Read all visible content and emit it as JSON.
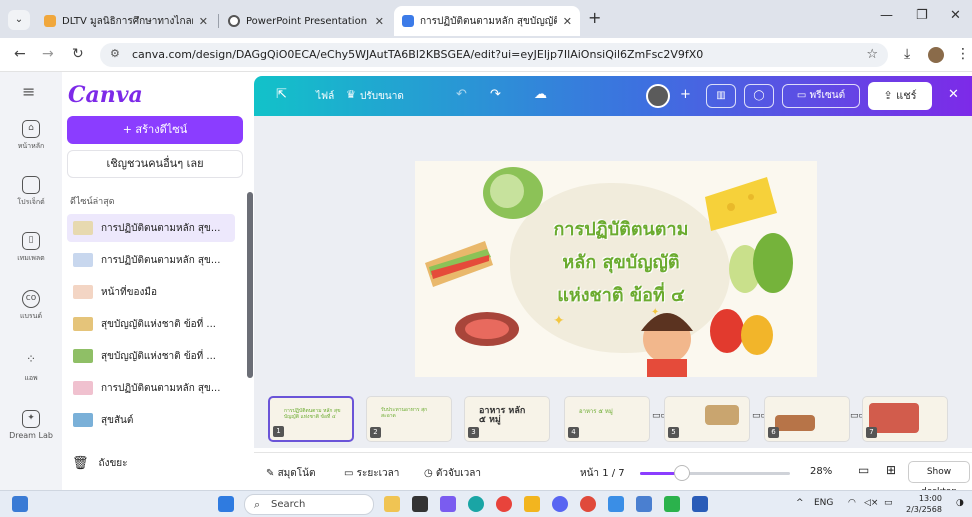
{
  "browser": {
    "tabs": [
      {
        "title": "DLTV มูลนิธิการศึกษาทางไกลผ่านดา",
        "active": false,
        "favicon_color": "#f0a73c"
      },
      {
        "title": "PowerPoint Presentation",
        "active": false,
        "favicon_color": "#555555"
      },
      {
        "title": "การปฏิบัติตนตามหลัก สุขบัญญัติแห่ง",
        "active": true,
        "favicon_color": "#3c7be8"
      }
    ],
    "url": "canva.com/design/DAGgQiO0ECA/eChy5WJAutTA6Bl2KBSGEA/edit?ui=eyJEljp7IlAiOnsiQil6ZmFsc2V9fX0"
  },
  "rail": {
    "items": [
      {
        "label": "หน้าหลัก",
        "icon": "home-icon"
      },
      {
        "label": "โปรเจ็กต์",
        "icon": "folder-icon"
      },
      {
        "label": "เทมเพลต",
        "icon": "template-icon"
      },
      {
        "label": "แบรนด์",
        "icon": "brand-icon"
      },
      {
        "label": "แอพ",
        "icon": "apps-icon"
      },
      {
        "label": "Dream Lab",
        "icon": "dream-lab-icon"
      }
    ]
  },
  "panel": {
    "logo": "Canva",
    "create_button": "+ สร้างดีไซน์",
    "invite_button": "เชิญชวนคนอื่นๆ เลย",
    "recent_label": "ดีไซน์ล่าสุด",
    "recent": [
      {
        "name": "การปฏิบัติตนตามหลัก สุข...",
        "selected": true,
        "thumb_color": "#e7d9b0"
      },
      {
        "name": "การปฏิบัติตนตามหลัก สุข...",
        "selected": false,
        "thumb_color": "#c8d7ee"
      },
      {
        "name": "หน้าที่ของมือ",
        "selected": false,
        "thumb_color": "#f3d5c4"
      },
      {
        "name": "สุขบัญญัติแห่งชาติ ข้อที่ ...",
        "selected": false,
        "thumb_color": "#e5c47a"
      },
      {
        "name": "สุขบัญญัติแห่งชาติ ข้อที่ ...",
        "selected": false,
        "thumb_color": "#8fbf66"
      },
      {
        "name": "การปฏิบัติตนตามหลัก สุข...",
        "selected": false,
        "thumb_color": "#f0c1cf"
      },
      {
        "name": "สุขสันต์",
        "selected": false,
        "thumb_color": "#7ab0d8"
      }
    ],
    "trash": "ถังขยะ"
  },
  "editor": {
    "file": "ไฟล์",
    "resize": "ปรับขนาด",
    "present": "พรีเซนต์",
    "share": "แชร์",
    "slide_title": [
      "การปฏิบัติตนตาม",
      "หลัก สุขบัญญัติ",
      "แห่งชาติ ข้อที่ ๔"
    ],
    "thumbnails": [
      {
        "num": "1",
        "text": "การปฏิบัติตนตาม หลัก สุขบัญญัติ แห่งชาติ ข้อที่ ๔",
        "selected": true
      },
      {
        "num": "2",
        "text": "รับประทานอาหาร สุก สะอาด",
        "selected": false
      },
      {
        "num": "3",
        "text": "อาหาร หลัก ๕ หมู่",
        "selected": false
      },
      {
        "num": "4",
        "text": "อาหาร ๕ หมู่",
        "selected": false
      },
      {
        "num": "5",
        "text": "",
        "selected": false
      },
      {
        "num": "6",
        "text": "",
        "selected": false
      },
      {
        "num": "7",
        "text": "",
        "selected": false
      }
    ],
    "footer": {
      "notes": "สมุดโน้ต",
      "duration": "ระยะเวลา",
      "timer": "ตัวจับเวลา",
      "page": "หน้า 1 / 7",
      "zoom": "28%",
      "zoom_fraction": 0.28,
      "show_desktop": "Show desktop"
    }
  },
  "taskbar": {
    "search": "Search",
    "lang": "ENG",
    "time": "13:00",
    "date": "2/3/2568"
  }
}
